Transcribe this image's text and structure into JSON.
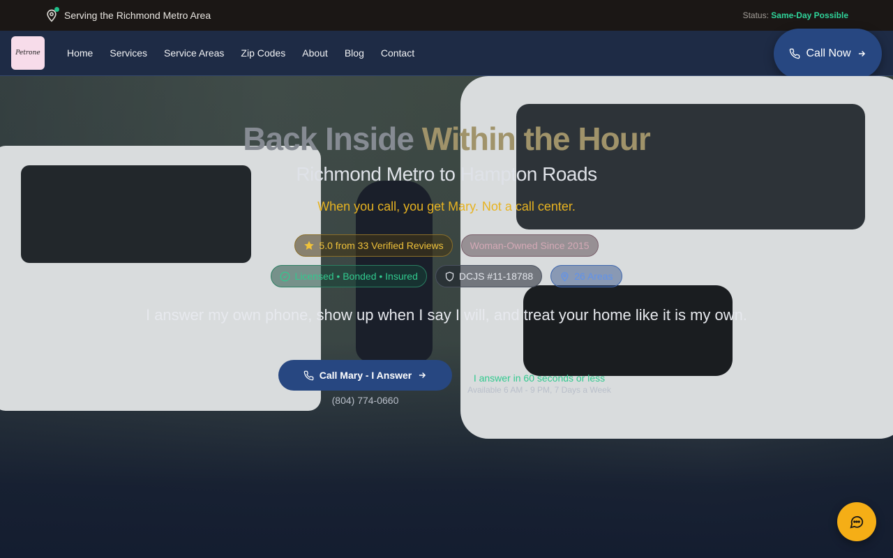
{
  "topbar": {
    "location": "Serving the Richmond Metro Area",
    "status_label": "Status:",
    "status_value": "Same-Day Possible"
  },
  "nav": {
    "logo_text": "Petrone",
    "items": [
      "Home",
      "Services",
      "Service Areas",
      "Zip Codes",
      "About",
      "Blog",
      "Contact"
    ],
    "call_label": "Call Now"
  },
  "hero": {
    "title_main": "Back Inside",
    "title_highlight": "Within the Hour",
    "subtitle": "Richmond Metro to Hampton Roads",
    "tagline": "When you call, you get Mary. Not a call center.",
    "badges_row1": [
      {
        "icon": "star-icon",
        "label": "5.0 from 33 Verified Reviews"
      },
      {
        "icon": "",
        "label": "Woman-Owned Since 2015"
      }
    ],
    "badges_row2": [
      {
        "icon": "check-circle-icon",
        "label": "Licensed • Bonded • Insured"
      },
      {
        "icon": "shield-icon",
        "label": "DCJS #11-18788"
      },
      {
        "icon": "map-pin-icon",
        "label": "26 Areas"
      }
    ],
    "description": "I answer my own phone, show up when I say I will, and treat your home like it is my own.",
    "cta_label": "Call Mary - I Answer",
    "phone": "(804) 774-0660",
    "answer_note": "I answer in 60 seconds or less",
    "availability": "Available 6 AM - 9 PM, 7 Days a Week"
  },
  "colors": {
    "accent_blue": "#274781",
    "gold": "#e7b321",
    "green": "#31c98e",
    "chat_orange": "#f5ae16"
  }
}
